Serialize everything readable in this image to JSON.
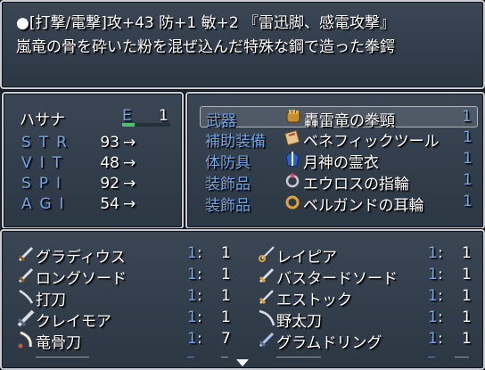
{
  "help": {
    "line1": "●[打撃/電撃]攻+43 防+1 敏+2 『雷迅脚、感電攻撃』",
    "line2": "嵐竜の骨を砕いた粉を混ぜ込んだ特殊な鋼で造った拳鍔"
  },
  "status": {
    "actor_name": "ハサナ",
    "level_label": "E",
    "level_value": "1",
    "exp_fraction": 0.25,
    "stats": [
      {
        "name": "STR",
        "value": "93",
        "arrow": "→"
      },
      {
        "name": "VIT",
        "value": "48",
        "arrow": "→"
      },
      {
        "name": "SPI",
        "value": "92",
        "arrow": "→"
      },
      {
        "name": "AGI",
        "value": "54",
        "arrow": "→"
      }
    ]
  },
  "slots": [
    {
      "type": "武器",
      "icon": "gauntlet-icon",
      "item": "轟雷竜の拳頸",
      "count": "1"
    },
    {
      "type": "補助装備",
      "icon": "scroll-icon",
      "item": "ベネフィックツール",
      "count": "1"
    },
    {
      "type": "体防具",
      "icon": "robe-icon",
      "item": "月神の霊衣",
      "count": "1"
    },
    {
      "type": "装飾品",
      "icon": "ring-icon",
      "item": "エウロスの指輪",
      "count": "1"
    },
    {
      "type": "装飾品",
      "icon": "earring-icon",
      "item": "ベルガンドの耳輪",
      "count": "1"
    }
  ],
  "items": [
    {
      "icon": "sword-icon",
      "name": "グラディウス",
      "count": "1",
      "colon": ":",
      "total": "1"
    },
    {
      "icon": "rapier-icon",
      "name": "レイピア",
      "count": "1",
      "colon": ":",
      "total": "1"
    },
    {
      "icon": "sword-icon",
      "name": "ロングソード",
      "count": "1",
      "colon": ":",
      "total": "1"
    },
    {
      "icon": "sword-icon",
      "name": "バスタードソード",
      "count": "1",
      "colon": ":",
      "total": "1"
    },
    {
      "icon": "katana-icon",
      "name": "打刀",
      "count": "1",
      "colon": ":",
      "total": "1"
    },
    {
      "icon": "sword-icon",
      "name": "エストック",
      "count": "1",
      "colon": ":",
      "total": "1"
    },
    {
      "icon": "sword-icon",
      "name": "クレイモア",
      "count": "1",
      "colon": ":",
      "total": "1"
    },
    {
      "icon": "nodachi-icon",
      "name": "野太刀",
      "count": "1",
      "colon": ":",
      "total": "1"
    },
    {
      "icon": "bone-sword-icon",
      "name": "竜骨刀",
      "count": "1",
      "colon": ":",
      "total": "7"
    },
    {
      "icon": "sword-icon",
      "name": "グラムドリング",
      "count": "1",
      "colon": ":",
      "total": "1"
    }
  ],
  "colors": {
    "system_blue": "#6fa8e6",
    "exp_green": "#4ac16a"
  }
}
